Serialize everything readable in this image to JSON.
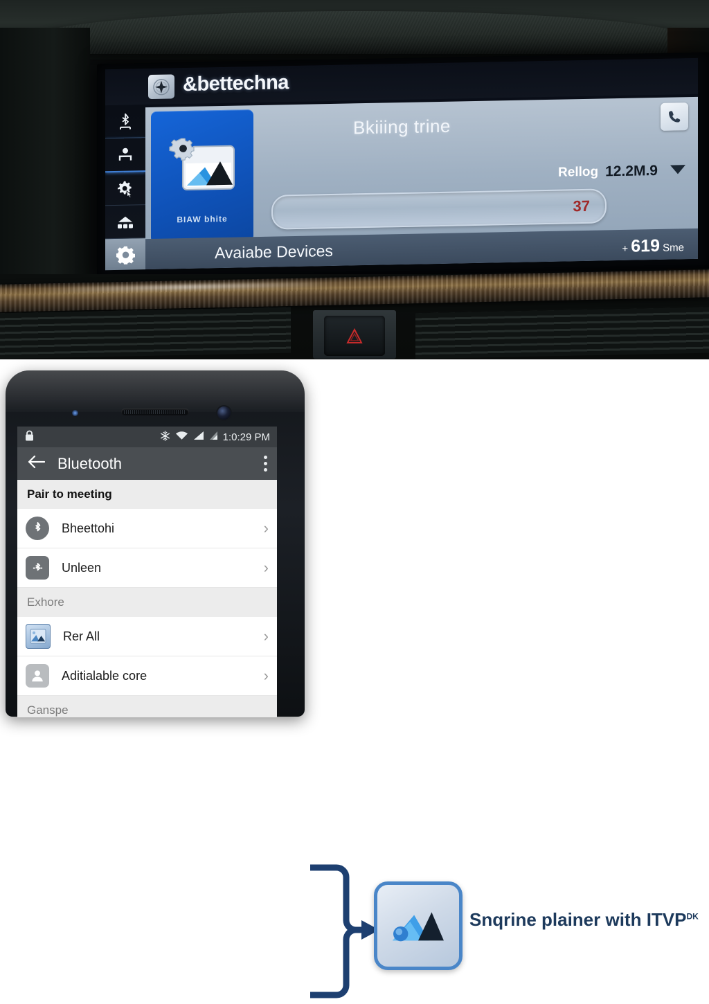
{
  "car_display": {
    "brand_title": "&bettechna",
    "logo_icon": "diamond-star-logo-icon",
    "rail_items": [
      {
        "name": "bluetooth",
        "icon": "bluetooth-icon"
      },
      {
        "name": "person",
        "icon": "person-icon"
      },
      {
        "name": "settings-cursor",
        "icon": "gear-cursor-icon"
      },
      {
        "name": "network",
        "icon": "network-nodes-icon"
      },
      {
        "name": "settings",
        "icon": "gear-icon"
      }
    ],
    "tile": {
      "label": "BIAW bhite",
      "icon": "folder-gear-image-icon"
    },
    "device_name": "Bkiiing trine",
    "phone_button_icon": "phone-handset-icon",
    "meta_label": "Rellog",
    "meta_value": "12.2M.9",
    "dropdown_icon": "caret-down-icon",
    "slider_value": "37",
    "footer_title": "Avaiabe Devices",
    "footer_count": "619",
    "footer_suffix": "Sme",
    "footer_prefix": "+"
  },
  "phone": {
    "status_bar": {
      "lock_icon": "lock-icon",
      "snow_icon": "snowflake-icon",
      "wifi_icon": "wifi-icon",
      "signal_icon": "signal-bars-icon",
      "sim_icon": "sim-signal-icon",
      "time": "1:0:29 PM"
    },
    "app_bar": {
      "back_icon": "back-arrow-icon",
      "title": "Bluetooth",
      "overflow_icon": "kebab-menu-icon"
    },
    "sections": [
      {
        "header": "Pair  to meeting",
        "header_style": "bold",
        "items": [
          {
            "label": "Bheettohi",
            "icon": "bluetooth-circle-icon",
            "chevron": "›"
          },
          {
            "label": "Unleen",
            "icon": "bluetooth-square-icon",
            "chevron": "›"
          }
        ]
      },
      {
        "header": "Exhore",
        "header_style": "muted",
        "items": [
          {
            "label": "Rer All",
            "icon": "image-thumbnail-icon",
            "chevron": "›"
          },
          {
            "label": "Aditialable core",
            "icon": "person-avatar-icon",
            "chevron": "›"
          }
        ]
      },
      {
        "header": "Ganspe",
        "header_style": "muted",
        "items": []
      }
    ]
  },
  "diagram": {
    "connector_icon": "brace-arrow-icon",
    "destination_icon": "mountain-image-app-icon",
    "caption": "Snqrine plainer with ITVP",
    "caption_sup": "DK"
  },
  "colors": {
    "accent_blue": "#1565d8",
    "diagram_blue": "#1d3a5c",
    "slider_red": "#a02a2a",
    "panel_bg": "#9fb0c2"
  }
}
